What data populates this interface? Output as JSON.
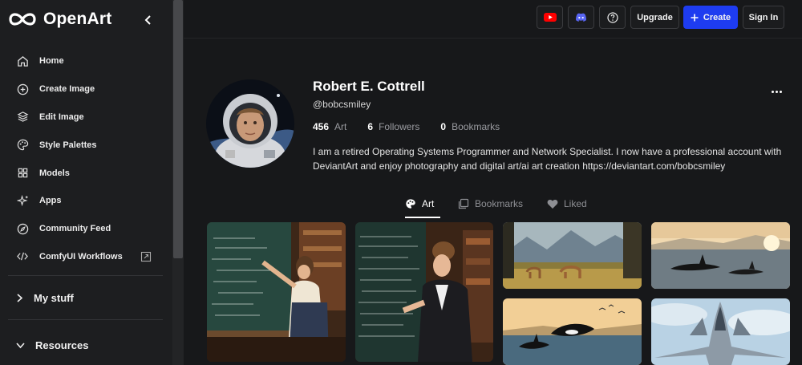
{
  "app": {
    "name": "OpenArt"
  },
  "sidebar": {
    "items": [
      {
        "label": "Home",
        "icon": "home-icon"
      },
      {
        "label": "Create Image",
        "icon": "plus-circle-icon"
      },
      {
        "label": "Edit Image",
        "icon": "layers-icon"
      },
      {
        "label": "Style Palettes",
        "icon": "palette-icon"
      },
      {
        "label": "Models",
        "icon": "grid-icon"
      },
      {
        "label": "Apps",
        "icon": "sparkle-icon"
      },
      {
        "label": "Community Feed",
        "icon": "compass-icon"
      },
      {
        "label": "ComfyUI Workflows",
        "icon": "code-icon"
      }
    ],
    "my_stuff": "My stuff",
    "resources": "Resources"
  },
  "topbar": {
    "upgrade": "Upgrade",
    "create": "Create",
    "signin": "Sign In",
    "youtube_color": "#ff0000",
    "discord_color": "#5865f2",
    "create_color": "#1e3cf0"
  },
  "profile": {
    "name": "Robert E. Cottrell",
    "handle": "@bobcsmiley",
    "stats": [
      {
        "value": "456",
        "label": "Art"
      },
      {
        "value": "6",
        "label": "Followers"
      },
      {
        "value": "0",
        "label": "Bookmarks"
      }
    ],
    "bio": "I am a retired Operating Systems Programmer and Network Specialist. I now have a professional account with DeviantArt and enjoy photography and digital art/ai art creation https://deviantart.com/bobcsmiley"
  },
  "tabs": [
    {
      "label": "Art",
      "active": true
    },
    {
      "label": "Bookmarks",
      "active": false
    },
    {
      "label": "Liked",
      "active": false
    }
  ]
}
